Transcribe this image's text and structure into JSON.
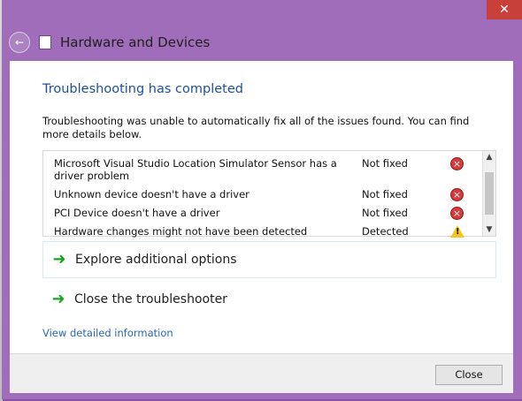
{
  "window": {
    "title": "Hardware and Devices",
    "close_symbol": "✕",
    "back_symbol": "←"
  },
  "content": {
    "heading": "Troubleshooting has completed",
    "description": "Troubleshooting was unable to automatically fix all of the issues found. You can find more details below."
  },
  "issues": [
    {
      "text": "Microsoft Visual Studio Location Simulator Sensor has a driver problem",
      "status": "Not fixed",
      "icon": "error-icon"
    },
    {
      "text": "Unknown device doesn't have a driver",
      "status": "Not fixed",
      "icon": "error-icon"
    },
    {
      "text": "PCI Device doesn't have a driver",
      "status": "Not fixed",
      "icon": "error-icon"
    },
    {
      "text": "Hardware changes might not have been detected",
      "status": "Detected",
      "icon": "warning-icon"
    }
  ],
  "options": {
    "explore": "Explore additional options",
    "close_troubleshooter": "Close the troubleshooter"
  },
  "links": {
    "view_details": "View detailed information"
  },
  "footer": {
    "close_button": "Close"
  },
  "icons": {
    "error_glyph": "×",
    "warning_glyph": "!",
    "arrow_glyph": "➜",
    "scroll_up": "▲",
    "scroll_down": "▼"
  }
}
